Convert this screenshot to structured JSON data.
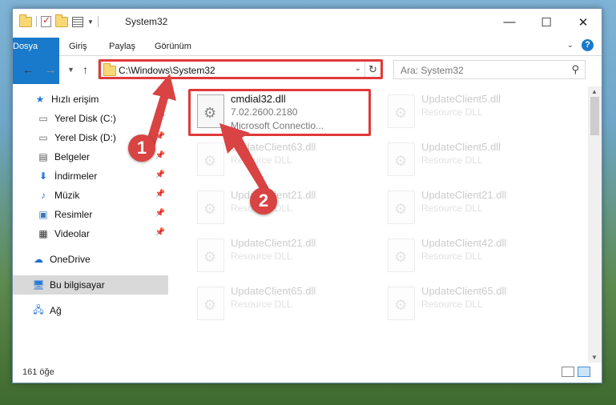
{
  "window": {
    "title": "System32",
    "controls": {
      "minimize": "—",
      "maximize": "☐",
      "close": "✕"
    }
  },
  "ribbon": {
    "tabs": [
      "Dosya",
      "Giriş",
      "Paylaş",
      "Görünüm"
    ],
    "help": "?"
  },
  "address": {
    "path": "C:\\Windows\\System32",
    "refresh": "↻"
  },
  "search": {
    "placeholder": "Ara: System32"
  },
  "sidebar": {
    "items": [
      {
        "label": "Hızlı erişim",
        "icon": "star-icon",
        "pinned": false
      },
      {
        "label": "Yerel Disk (C:)",
        "icon": "drive-icon",
        "pinned": true
      },
      {
        "label": "Yerel Disk (D:)",
        "icon": "drive-icon",
        "pinned": true
      },
      {
        "label": "Belgeler",
        "icon": "documents-icon",
        "pinned": true
      },
      {
        "label": "İndirmeler",
        "icon": "download-icon",
        "pinned": true
      },
      {
        "label": "Müzik",
        "icon": "music-icon",
        "pinned": true
      },
      {
        "label": "Resimler",
        "icon": "pictures-icon",
        "pinned": true
      },
      {
        "label": "Videolar",
        "icon": "videos-icon",
        "pinned": true
      },
      {
        "label": "OneDrive",
        "icon": "cloud-icon",
        "pinned": false
      },
      {
        "label": "Bu bilgisayar",
        "icon": "computer-icon",
        "pinned": false
      },
      {
        "label": "Ağ",
        "icon": "network-icon",
        "pinned": false
      }
    ]
  },
  "files": [
    {
      "name": "cmdial32.dll",
      "line2": "7.02.2600.2180",
      "line3": "Microsoft Connectio..."
    },
    {
      "name": "UpdateClient5.dll",
      "line2": "Resource DLL"
    },
    {
      "name": "UpdateClient63.dll",
      "line2": "Resource DLL"
    },
    {
      "name": "UpdateClient5.dll",
      "line2": "Resource DLL"
    },
    {
      "name": "UpdateClient21.dll",
      "line2": "Resource DLL"
    },
    {
      "name": "UpdateClient21.dll",
      "line2": "Resource DLL"
    },
    {
      "name": "UpdateClient21.dll",
      "line2": "Resource DLL"
    },
    {
      "name": "UpdateClient42.dll",
      "line2": "Resource DLL"
    },
    {
      "name": "UpdateClient65.dll",
      "line2": "Resource DLL"
    },
    {
      "name": "UpdateClient65.dll",
      "line2": "Resource DLL"
    }
  ],
  "status": {
    "count": "161 öğe"
  },
  "callouts": [
    "1",
    "2"
  ],
  "colors": {
    "accent": "#1979ca",
    "annotation": "#e03a3a"
  }
}
